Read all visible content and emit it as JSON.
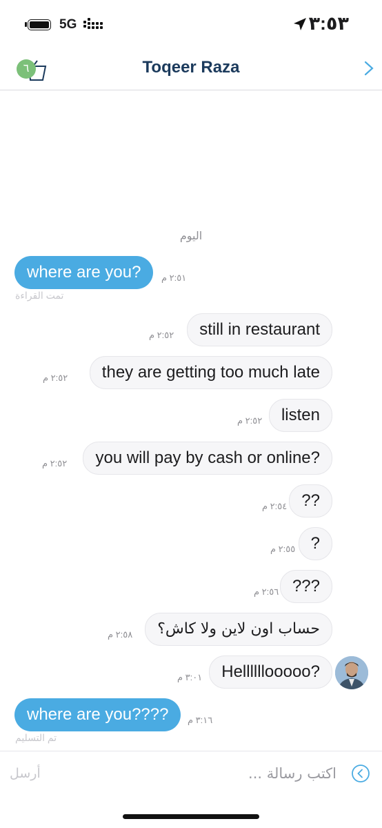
{
  "status_bar": {
    "time": "٣:٥٣",
    "network": "5G"
  },
  "header": {
    "title": "Toqeer Raza",
    "cart_badge": "٦"
  },
  "day_label": "اليوم",
  "messages": [
    {
      "text": "where are you?",
      "time": "٢:٥١ م",
      "receipt": "تمت القراءة"
    },
    {
      "text": "still in restaurant",
      "time": "٢:٥٢ م"
    },
    {
      "text": "they are getting too much late",
      "time": "٢:٥٢ م"
    },
    {
      "text": "listen",
      "time": "٢:٥٢ م"
    },
    {
      "text": "you will pay by cash or online?",
      "time": "٢:٥٢ م"
    },
    {
      "text": "??",
      "time": "٢:٥٤ م"
    },
    {
      "text": "?",
      "time": "٢:٥٥ م"
    },
    {
      "text": "???",
      "time": "٢:٥٦ م"
    },
    {
      "text": "حساب اون لاين ولا كاش؟",
      "time": "٢:٥٨ م"
    },
    {
      "text": "Hellllllooooo?",
      "time": "٣:٠١ م"
    },
    {
      "text": "where are you????",
      "time": "٣:١٦ م",
      "receipt": "تم التسليم"
    }
  ],
  "composer": {
    "placeholder": "اكتب رسالة ...",
    "send_label": "أرسل"
  },
  "colors": {
    "outgoing_bubble": "#4aabe2",
    "incoming_bubble": "#f6f6f8",
    "title": "#1b3a5c",
    "badge": "#7cc079"
  }
}
